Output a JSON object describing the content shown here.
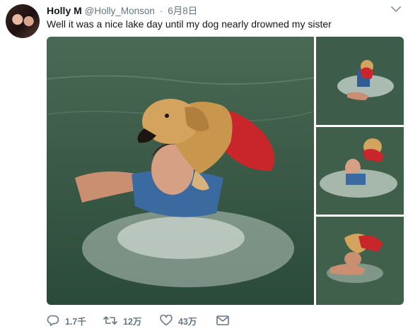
{
  "tweet": {
    "author_name": "Holly M",
    "author_handle": "@Holly_Monson",
    "separator": "·",
    "date": "6月8日",
    "text": "Well it was a nice lake day until my dog nearly drowned my sister",
    "actions": {
      "reply_count": "1.7千",
      "retweet_count": "12万",
      "like_count": "43万"
    },
    "icons": {
      "caret": "chevron-down-icon",
      "reply": "reply-icon",
      "retweet": "retweet-icon",
      "like": "heart-icon",
      "dm": "envelope-icon"
    }
  },
  "colors": {
    "text": "#14171a",
    "muted": "#657786",
    "lake_water": "#3f5e49"
  }
}
